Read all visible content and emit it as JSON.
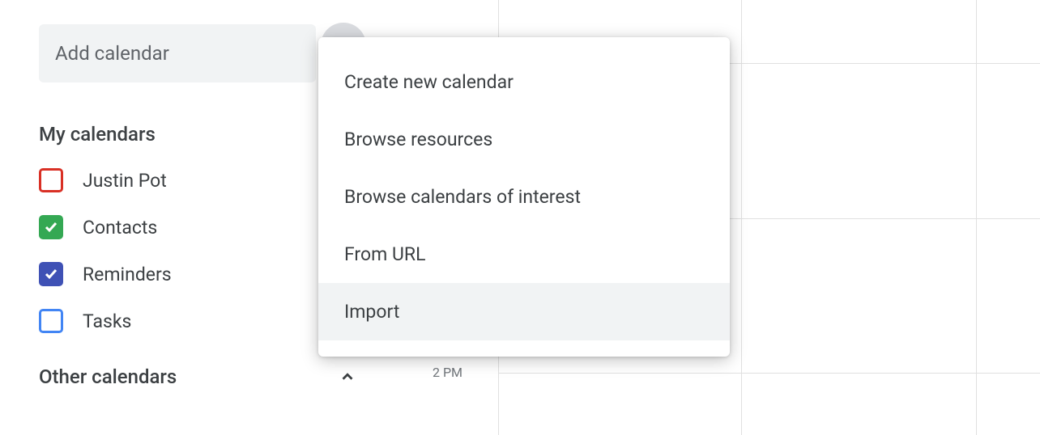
{
  "sidebar": {
    "add_calendar_placeholder": "Add calendar",
    "my_calendars_header": "My calendars",
    "other_calendars_header": "Other calendars",
    "calendars": [
      {
        "label": "Justin Pot",
        "checked": false,
        "color": "#d93025"
      },
      {
        "label": "Contacts",
        "checked": true,
        "color": "#34a853"
      },
      {
        "label": "Reminders",
        "checked": true,
        "color": "#3f51b5"
      },
      {
        "label": "Tasks",
        "checked": false,
        "color": "#4285f4"
      }
    ]
  },
  "popup": {
    "items": [
      {
        "label": "Create new calendar"
      },
      {
        "label": "Browse resources"
      },
      {
        "label": "Browse calendars of interest"
      },
      {
        "label": "From URL"
      },
      {
        "label": "Import"
      }
    ]
  },
  "grid": {
    "time_label": "2 PM"
  }
}
